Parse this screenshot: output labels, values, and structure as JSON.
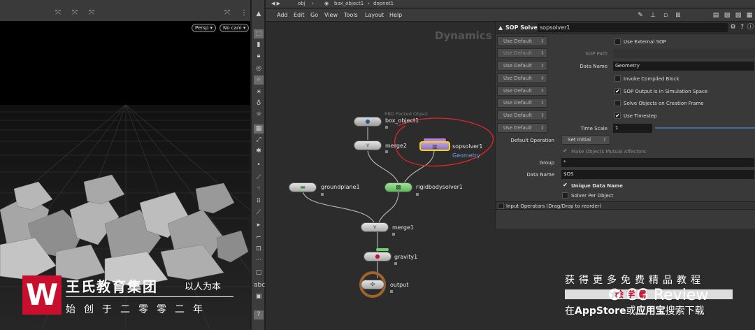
{
  "viewport": {
    "camera_pill": "Persp",
    "cam_pill": "No cam"
  },
  "brand": {
    "logo_letter": "W",
    "title": "王氏教育集团",
    "subtitle": "以人为本",
    "slogan": "始创于二零零二年"
  },
  "network": {
    "path": [
      "obj",
      "box_object1",
      "dopnet1"
    ],
    "menu": [
      "Add",
      "Edit",
      "Go",
      "View",
      "Tools",
      "Layout",
      "Help"
    ],
    "context_label": "Dynamics",
    "nodes": {
      "box_object1": {
        "name": "box_object1",
        "type_label": "RBD Packed Object"
      },
      "merge2": {
        "name": "merge2"
      },
      "sopsolver1": {
        "name": "sopsolver1",
        "sub": "Geometry"
      },
      "groundplane1": {
        "name": "groundplane1"
      },
      "rigidbodysolver1": {
        "name": "rigidbodysolver1"
      },
      "merge1": {
        "name": "merge1"
      },
      "gravity1": {
        "name": "gravity1"
      },
      "output": {
        "name": "output"
      }
    },
    "annotation_color": "#e0262b",
    "selected_color": "#f2d21b"
  },
  "params": {
    "node_type": "SOP Solver",
    "node_name": "sopsolver1",
    "use_default": "Use Default",
    "use_external_sop": "Use External SOP",
    "sop_path": "SOP Path",
    "data_name_label": "Data Name",
    "data_name_value": "Geometry",
    "invoke_compiled": "Invoke Compiled Block",
    "sop_output_sim": "SOP Output is in Simulation Space",
    "solve_on_creation": "Solve Objects on Creation Frame",
    "use_timestep": "Use Timestep",
    "time_scale_label": "Time Scale",
    "time_scale_value": "1",
    "default_op_label": "Default Operation",
    "default_op_value": "Set Initial",
    "mutual_affectors": "Make Objects Mutual Affectors",
    "group_label": "Group",
    "group_value": "*",
    "data_name2_label": "Data Name",
    "data_name2_value": "$OS",
    "unique_data_name": "Unique Data Name",
    "solver_per_object": "Solver Per Object",
    "input_operators": "Input Operators (Drag/Drop to reorder)"
  },
  "watermark": {
    "line1": "获得更多免费精品教程",
    "bar_text": "绘 学 霸",
    "logo_text": "CG Review",
    "line3_pre": "在",
    "line3_app": "AppStore",
    "line3_mid": "或",
    "line3_store": "应用宝",
    "line3_post": "搜索下载"
  }
}
